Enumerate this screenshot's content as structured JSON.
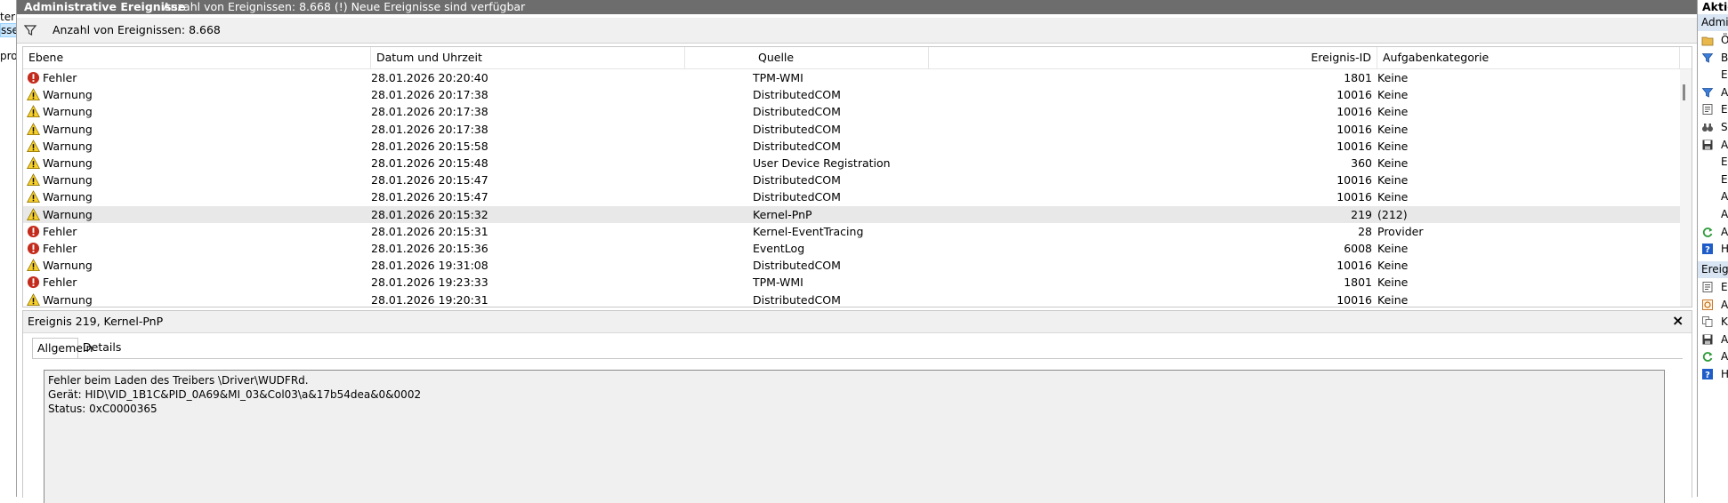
{
  "left_pane": {
    "fragments": [
      "ter",
      "sse",
      "pro"
    ]
  },
  "header": {
    "title": "Administrative Ereignisse",
    "info": "Anzahl von Ereignissen: 8.668 (!) Neue Ereignisse sind verfügbar"
  },
  "filter": {
    "icon": "filter-icon",
    "text": "Anzahl von Ereignissen: 8.668"
  },
  "columns": {
    "level": "Ebene",
    "date": "Datum und Uhrzeit",
    "source": "Quelle",
    "id": "Ereignis-ID",
    "category": "Aufgabenkategorie"
  },
  "events": [
    {
      "level": "Fehler",
      "kind": "error",
      "date": "28.01.2026 20:20:40",
      "source": "TPM-WMI",
      "id": "1801",
      "category": "Keine"
    },
    {
      "level": "Warnung",
      "kind": "warning",
      "date": "28.01.2026 20:17:38",
      "source": "DistributedCOM",
      "id": "10016",
      "category": "Keine"
    },
    {
      "level": "Warnung",
      "kind": "warning",
      "date": "28.01.2026 20:17:38",
      "source": "DistributedCOM",
      "id": "10016",
      "category": "Keine"
    },
    {
      "level": "Warnung",
      "kind": "warning",
      "date": "28.01.2026 20:17:38",
      "source": "DistributedCOM",
      "id": "10016",
      "category": "Keine"
    },
    {
      "level": "Warnung",
      "kind": "warning",
      "date": "28.01.2026 20:15:58",
      "source": "DistributedCOM",
      "id": "10016",
      "category": "Keine"
    },
    {
      "level": "Warnung",
      "kind": "warning",
      "date": "28.01.2026 20:15:48",
      "source": "User Device Registration",
      "id": "360",
      "category": "Keine"
    },
    {
      "level": "Warnung",
      "kind": "warning",
      "date": "28.01.2026 20:15:47",
      "source": "DistributedCOM",
      "id": "10016",
      "category": "Keine"
    },
    {
      "level": "Warnung",
      "kind": "warning",
      "date": "28.01.2026 20:15:47",
      "source": "DistributedCOM",
      "id": "10016",
      "category": "Keine"
    },
    {
      "level": "Warnung",
      "kind": "warning",
      "date": "28.01.2026 20:15:32",
      "source": "Kernel-PnP",
      "id": "219",
      "category": "(212)",
      "selected": true
    },
    {
      "level": "Fehler",
      "kind": "error",
      "date": "28.01.2026 20:15:31",
      "source": "Kernel-EventTracing",
      "id": "28",
      "category": "Provider"
    },
    {
      "level": "Fehler",
      "kind": "error",
      "date": "28.01.2026 20:15:36",
      "source": "EventLog",
      "id": "6008",
      "category": "Keine"
    },
    {
      "level": "Warnung",
      "kind": "warning",
      "date": "28.01.2026 19:31:08",
      "source": "DistributedCOM",
      "id": "10016",
      "category": "Keine"
    },
    {
      "level": "Fehler",
      "kind": "error",
      "date": "28.01.2026 19:23:33",
      "source": "TPM-WMI",
      "id": "1801",
      "category": "Keine"
    },
    {
      "level": "Warnung",
      "kind": "warning",
      "date": "28.01.2026 19:20:31",
      "source": "DistributedCOM",
      "id": "10016",
      "category": "Keine"
    }
  ],
  "detail": {
    "title": "Ereignis 219, Kernel-PnP",
    "close": "×",
    "tabs": [
      "Allgemein",
      "Details"
    ],
    "message": [
      "Fehler beim Laden des Treibers \\Driver\\WUDFRd.",
      "Gerät: HID\\VID_1B1C&PID_0A69&MI_03&Col03\\a&17b54dea&0&0002",
      "Status: 0xC0000365"
    ]
  },
  "actions": {
    "title": "Aktio",
    "sections": [
      {
        "label": "Admi",
        "items": [
          {
            "icon": "open-folder-icon",
            "letter": "Ö"
          },
          {
            "icon": "filter-icon",
            "letter": "B"
          },
          {
            "icon": "",
            "letter": "E"
          },
          {
            "icon": "filter-icon",
            "letter": "A"
          },
          {
            "icon": "properties-icon",
            "letter": "E"
          },
          {
            "icon": "find-binoculars-icon",
            "letter": "S"
          },
          {
            "icon": "save-icon",
            "letter": "A"
          },
          {
            "icon": "",
            "letter": "E"
          },
          {
            "icon": "",
            "letter": "E"
          },
          {
            "icon": "",
            "letter": "A"
          },
          {
            "icon": "",
            "letter": "A"
          },
          {
            "icon": "refresh-icon",
            "letter": "A"
          },
          {
            "icon": "help-icon",
            "letter": "H"
          }
        ]
      },
      {
        "label": "Ereig",
        "items": [
          {
            "icon": "properties-icon",
            "letter": "E"
          },
          {
            "icon": "attach-task-icon",
            "letter": "A"
          },
          {
            "icon": "copy-icon",
            "letter": "K"
          },
          {
            "icon": "save-icon",
            "letter": "A"
          },
          {
            "icon": "refresh-icon",
            "letter": "A"
          },
          {
            "icon": "help-icon",
            "letter": "H"
          }
        ]
      }
    ]
  },
  "colors": {
    "header_bg": "#6d6d6d",
    "selected_row": "#e8e8e8",
    "error_red": "#c42b1c",
    "warning_yellow": "#f7d02c",
    "section_head": "#d9e5f3"
  }
}
